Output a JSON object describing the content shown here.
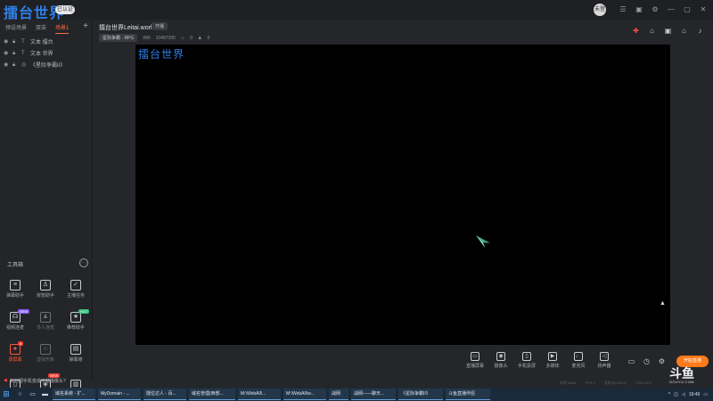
{
  "app": {
    "brand": "擂台世界",
    "brand_badge": "已认证"
  },
  "window_controls": [
    "avatar",
    "minimize",
    "settings",
    "box",
    "restore",
    "close"
  ],
  "avatar_text": "未登",
  "scene_tabs": [
    {
      "label": "预设场景",
      "active": false
    },
    {
      "label": "双击",
      "active": false
    },
    {
      "label": "场景1",
      "active": true
    }
  ],
  "sources": [
    {
      "label": "文本 擂台"
    },
    {
      "label": "文本 世界"
    },
    {
      "label": "《星际争霸II》"
    }
  ],
  "room": {
    "title": "擂台世界Leitai.world",
    "tag": "开播",
    "category": "星际争霸 · RPG",
    "meta_extra": "Wifi",
    "room_id": "10487395",
    "fire": "0",
    "viewers": "0"
  },
  "toolbox": {
    "title": "工具箱",
    "tools": [
      {
        "label": "弹幕助手",
        "state": "normal",
        "badge": ""
      },
      {
        "label": "房管助手",
        "state": "normal",
        "badge": ""
      },
      {
        "label": "主播任务",
        "state": "normal",
        "badge": ""
      },
      {
        "label": "视频连麦",
        "state": "normal",
        "badge": "NEW"
      },
      {
        "label": "多人连麦",
        "state": "dim",
        "badge": ""
      },
      {
        "label": "推荐助手",
        "state": "normal",
        "badge": "HOT"
      },
      {
        "label": "录屏幕",
        "state": "hot",
        "badge": "●"
      },
      {
        "label": "虚拟形象",
        "state": "dim",
        "badge": ""
      },
      {
        "label": "弹幕墙",
        "state": "normal",
        "badge": ""
      },
      {
        "label": "",
        "state": "normal",
        "badge": ""
      },
      {
        "label": "",
        "state": "normal",
        "badge": "NEW"
      },
      {
        "label": "",
        "state": "normal",
        "badge": ""
      }
    ]
  },
  "preview": {
    "overlay_text": "擂台世界"
  },
  "bottom_controls": [
    {
      "label": "直播屏幕",
      "icon": "screen-icon"
    },
    {
      "label": "摄像头",
      "icon": "camera-icon"
    },
    {
      "label": "手机投屏",
      "icon": "phone-cast-icon"
    },
    {
      "label": "多媒体",
      "icon": "media-icon"
    },
    {
      "label": "麦克风",
      "icon": "mic-icon"
    },
    {
      "label": "扬声器",
      "icon": "speaker-icon"
    }
  ],
  "live_button": "开始直播",
  "stats": [
    "码率 0kb/s",
    "FPS 0",
    "丢帧 0(0.00%)",
    "CPU 22%"
  ],
  "notice": "如何把手机变成电脑摄像头?",
  "watermark": {
    "logo": "斗鱼",
    "url": "DOUYU.COM"
  },
  "taskbar": {
    "items": [
      "域名系统 - 扩...",
      "MyDomain - ...",
      "擂位达人 - 百...",
      "域名管理(西部...",
      "M:\\WebAll\\...",
      "M:\\WebAll\\w...",
      "战网",
      "战网——聊天...",
      "《星际争霸II》",
      "斗鱼直播伴侣"
    ],
    "time": "19:49"
  }
}
